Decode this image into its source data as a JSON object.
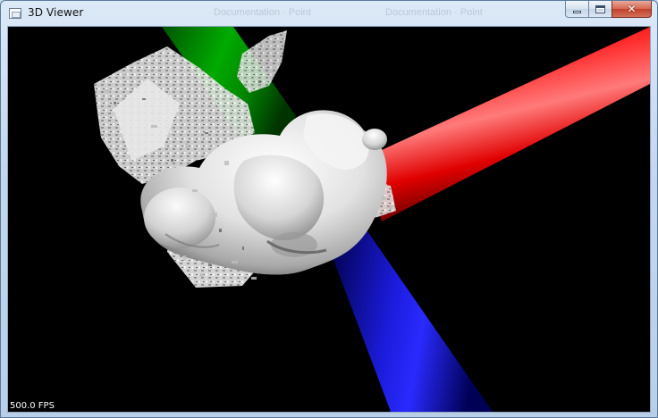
{
  "window": {
    "title": "3D Viewer",
    "controls": {
      "minimize_icon": "minimize-icon",
      "maximize_icon": "maximize-icon",
      "close_glyph": "✕"
    }
  },
  "background_tabs": [
    "Documentation · Point",
    "Documentation · Point"
  ],
  "viewport": {
    "fps_label": "500.0 FPS",
    "background_color": "#000000",
    "axes": {
      "x_color": "#e00000",
      "y_color": "#00a000",
      "z_color": "#0000cc"
    },
    "model_color": "#e6e6e6"
  }
}
